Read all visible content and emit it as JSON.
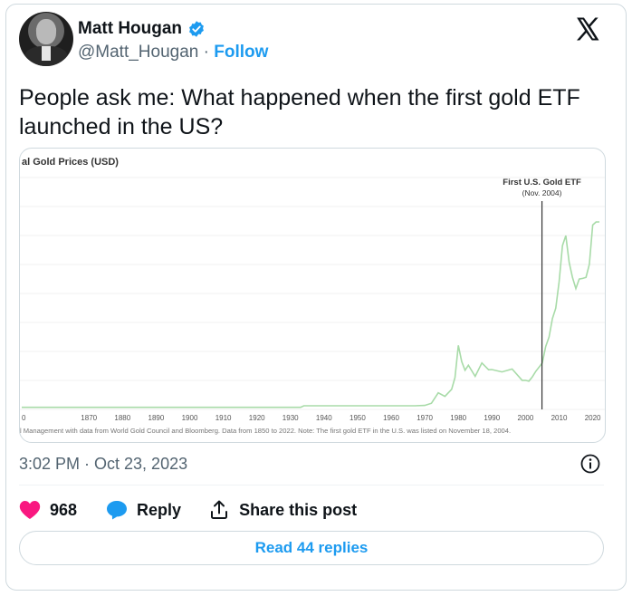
{
  "author": {
    "name": "Matt Hougan",
    "handle": "@Matt_Hougan",
    "follow_label": "Follow",
    "verified_color": "#1d9bf0"
  },
  "tweet": {
    "text": "People ask me: What happened when the first gold ETF launched in the US?",
    "timestamp": "3:02 PM · Oct 23, 2023"
  },
  "chart_data": {
    "type": "line",
    "title": "al Gold Prices (USD)",
    "annotation": {
      "label": "First U.S. Gold ETF",
      "sublabel": "(Nov. 2004)",
      "x": 2004.9
    },
    "x_ticks": [
      "0",
      "1870",
      "1880",
      "1890",
      "1900",
      "1910",
      "1920",
      "1930",
      "1940",
      "1950",
      "1960",
      "1970",
      "1980",
      "1990",
      "2000",
      "2010",
      "2020"
    ],
    "xlim": [
      1850,
      2022
    ],
    "grid": true,
    "series": [
      {
        "color": "#a8dba8",
        "x": [
          1850,
          1900,
          1933,
          1934,
          1967,
          1970,
          1972,
          1974,
          1976,
          1978,
          1979,
          1980,
          1981,
          1982,
          1983,
          1985,
          1987,
          1989,
          1990,
          1993,
          1996,
          1999,
          2000,
          2001,
          2002,
          2003,
          2005,
          2006,
          2007,
          2008,
          2009,
          2010,
          2011,
          2012,
          2013,
          2014,
          2015,
          2016,
          2017,
          2018,
          2019,
          2020,
          2021,
          2022
        ],
        "y": [
          20,
          20,
          20,
          35,
          35,
          38,
          59,
          159,
          125,
          193,
          306,
          615,
          460,
          376,
          424,
          317,
          446,
          381,
          383,
          360,
          388,
          279,
          279,
          271,
          310,
          363,
          445,
          604,
          695,
          872,
          972,
          1225,
          1572,
          1669,
          1411,
          1266,
          1160,
          1251,
          1257,
          1268,
          1393,
          1770,
          1799,
          1800
        ]
      }
    ],
    "ylim": [
      0,
      2000
    ],
    "footnote": "l Management with data from World Gold Council and Bloomberg. Data from 1850 to 2022. Note: The first gold ETF in the U.S. was listed on November 18, 2004."
  },
  "actions": {
    "like_count": "968",
    "reply_label": "Reply",
    "share_label": "Share this post",
    "like_color": "#f91880",
    "reply_color": "#1d9bf0"
  },
  "read_replies_label": "Read 44 replies"
}
